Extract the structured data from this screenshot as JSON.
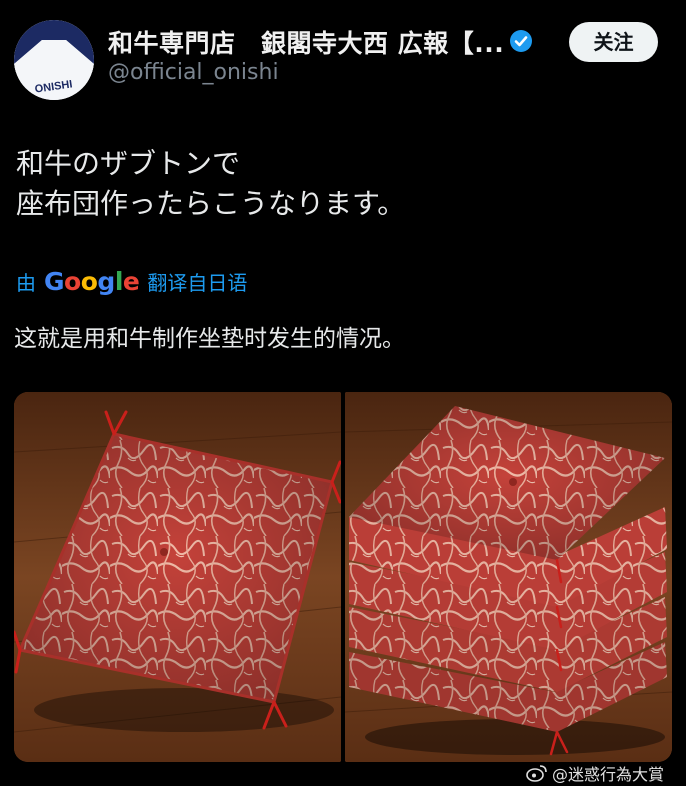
{
  "tweet": {
    "author_name": "和牛専門店　銀閣寺大西 広報【...",
    "author_handle": "@official_onishi",
    "avatar_logo_text": "ONISHI",
    "follow_label": "关注",
    "text_line1": "和牛のザブトンで",
    "text_line2": "座布団作ったらこうなります。",
    "translate_prefix": "由",
    "translate_brand": "Google",
    "translate_suffix": "翻译自日语",
    "translated_text": "这就是用和牛制作坐垫时发生的情况。"
  },
  "photos": [
    {
      "subject": "single-wagyu-cushion"
    },
    {
      "subject": "stacked-wagyu-cushions"
    }
  ],
  "watermark": {
    "text": "@迷惑行為大賞",
    "icon": "weibo-icon"
  },
  "colors": {
    "background": "#000000",
    "text": "#e7e9ea",
    "muted": "#7b8590",
    "link": "#1d9bf0",
    "verified": "#1d9bf0",
    "cushion": "#c6463a",
    "marbling": "#f0b9a6",
    "floor": "#6b3a1c"
  }
}
